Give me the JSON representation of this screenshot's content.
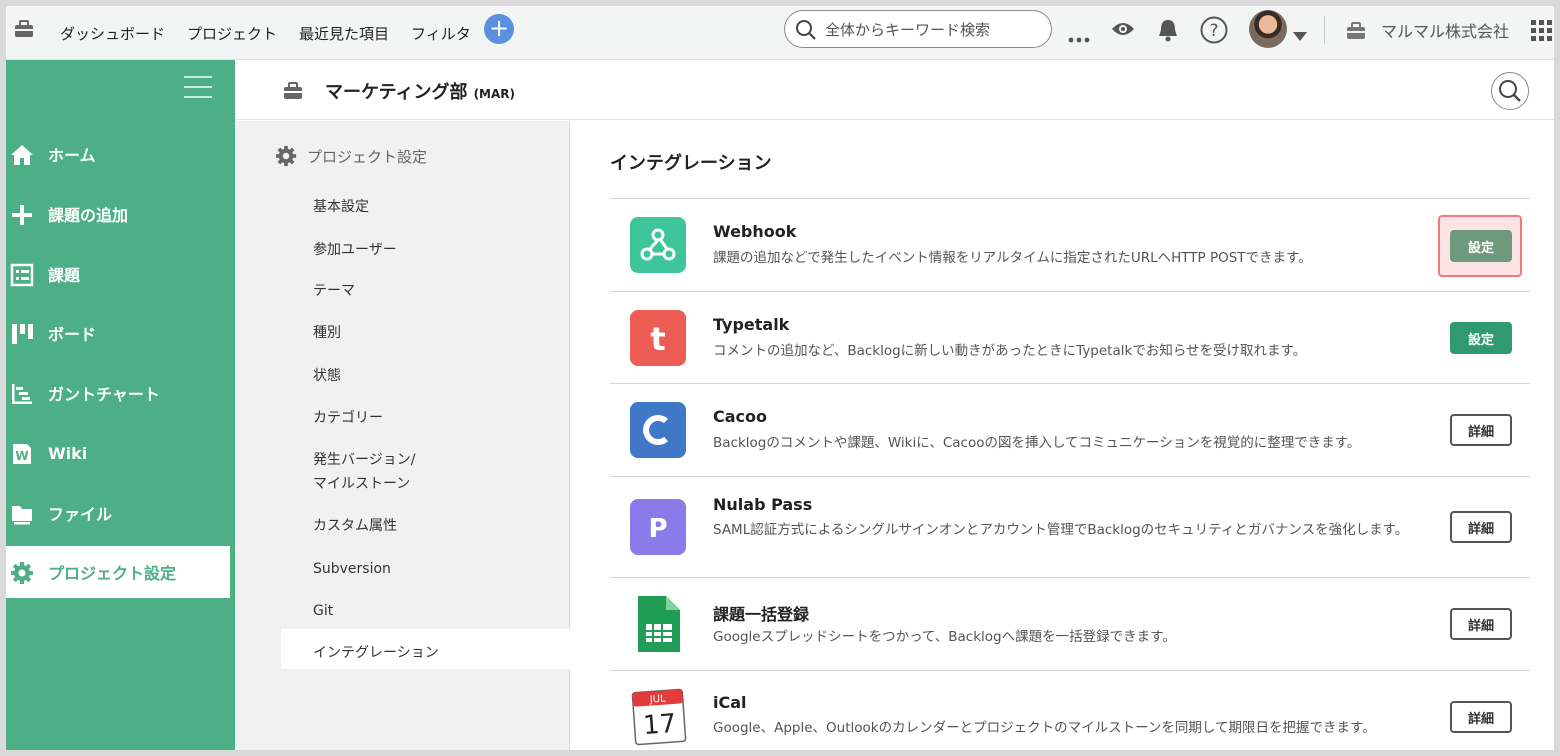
{
  "topbar": {
    "nav": [
      "ダッシュボード",
      "プロジェクト",
      "最近見た項目",
      "フィルタ"
    ],
    "search_placeholder": "全体からキーワード検索",
    "company": "マルマル株式会社"
  },
  "sidebar": {
    "items": [
      {
        "label": "ホーム",
        "icon": "home-icon"
      },
      {
        "label": "課題の追加",
        "icon": "plus-icon"
      },
      {
        "label": "課題",
        "icon": "list-icon"
      },
      {
        "label": "ボード",
        "icon": "board-icon"
      },
      {
        "label": "ガントチャート",
        "icon": "gantt-icon"
      },
      {
        "label": "Wiki",
        "icon": "wiki-icon"
      },
      {
        "label": "ファイル",
        "icon": "folder-icon"
      },
      {
        "label": "プロジェクト設定",
        "icon": "gear-icon",
        "active": true
      }
    ],
    "accent": "#4caf86"
  },
  "project": {
    "name": "マーケティング部",
    "key": "(MAR)"
  },
  "settings_nav": {
    "heading": "プロジェクト設定",
    "items": [
      "基本設定",
      "参加ユーザー",
      "テーマ",
      "種別",
      "状態",
      "カテゴリー",
      "発生バージョン/",
      "マイルストーン",
      "カスタム属性",
      "Subversion",
      "Git",
      "インテグレーション"
    ]
  },
  "main": {
    "title": "インテグレーション",
    "integrations": [
      {
        "name": "Webhook",
        "desc": "課題の追加などで発生したイベント情報をリアルタイムに指定されたURLへHTTP POSTできます。",
        "button": "設定",
        "color": "#3ec59a"
      },
      {
        "name": "Typetalk",
        "desc": "コメントの追加など、Backlogに新しい動きがあったときにTypetalkでお知らせを受け取れます。",
        "button": "設定",
        "color": "#ee5d55"
      },
      {
        "name": "Cacoo",
        "desc": "Backlogのコメントや課題、Wikiに、Cacooの図を挿入してコミュニケーションを視覚的に整理できます。",
        "button": "詳細",
        "color": "#3f78c7"
      },
      {
        "name": "Nulab Pass",
        "desc": "SAML認証方式によるシングルサインオンとアカウント管理でBacklogのセキュリティとガバナンスを強化します。",
        "button": "詳細",
        "color": "#8b7bea"
      },
      {
        "name": "課題一括登録",
        "desc": "Googleスプレッドシートをつかって、Backlogへ課題を一括登録できます。",
        "button": "詳細",
        "color": "#1f9d55"
      },
      {
        "name": "iCal",
        "desc": "Google、Apple、Outlookのカレンダーとプロジェクトのマイルストーンを同期して期限日を把握できます。",
        "button": "詳細",
        "color": "#e23b3b"
      }
    ],
    "ical_month": "JUL",
    "ical_day": "17"
  }
}
